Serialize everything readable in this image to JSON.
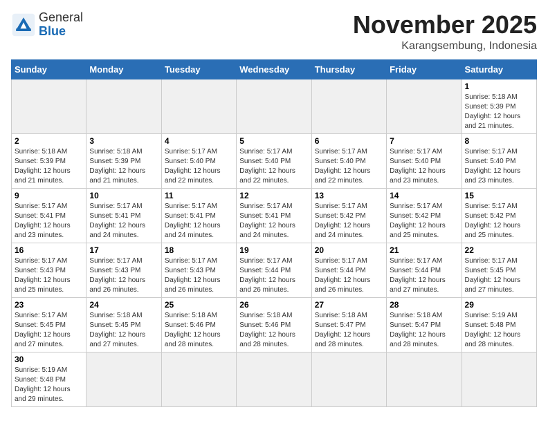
{
  "header": {
    "logo_general": "General",
    "logo_blue": "Blue",
    "title": "November 2025",
    "subtitle": "Karangsembung, Indonesia"
  },
  "weekdays": [
    "Sunday",
    "Monday",
    "Tuesday",
    "Wednesday",
    "Thursday",
    "Friday",
    "Saturday"
  ],
  "weeks": [
    [
      {
        "day": "",
        "empty": true
      },
      {
        "day": "",
        "empty": true
      },
      {
        "day": "",
        "empty": true
      },
      {
        "day": "",
        "empty": true
      },
      {
        "day": "",
        "empty": true
      },
      {
        "day": "",
        "empty": true
      },
      {
        "day": "1",
        "sunrise": "5:18 AM",
        "sunset": "5:39 PM",
        "daylight": "12 hours and 21 minutes."
      }
    ],
    [
      {
        "day": "2",
        "sunrise": "5:18 AM",
        "sunset": "5:39 PM",
        "daylight": "12 hours and 21 minutes."
      },
      {
        "day": "3",
        "sunrise": "5:18 AM",
        "sunset": "5:39 PM",
        "daylight": "12 hours and 21 minutes."
      },
      {
        "day": "4",
        "sunrise": "5:17 AM",
        "sunset": "5:40 PM",
        "daylight": "12 hours and 22 minutes."
      },
      {
        "day": "5",
        "sunrise": "5:17 AM",
        "sunset": "5:40 PM",
        "daylight": "12 hours and 22 minutes."
      },
      {
        "day": "6",
        "sunrise": "5:17 AM",
        "sunset": "5:40 PM",
        "daylight": "12 hours and 22 minutes."
      },
      {
        "day": "7",
        "sunrise": "5:17 AM",
        "sunset": "5:40 PM",
        "daylight": "12 hours and 23 minutes."
      },
      {
        "day": "8",
        "sunrise": "5:17 AM",
        "sunset": "5:40 PM",
        "daylight": "12 hours and 23 minutes."
      }
    ],
    [
      {
        "day": "9",
        "sunrise": "5:17 AM",
        "sunset": "5:41 PM",
        "daylight": "12 hours and 23 minutes."
      },
      {
        "day": "10",
        "sunrise": "5:17 AM",
        "sunset": "5:41 PM",
        "daylight": "12 hours and 24 minutes."
      },
      {
        "day": "11",
        "sunrise": "5:17 AM",
        "sunset": "5:41 PM",
        "daylight": "12 hours and 24 minutes."
      },
      {
        "day": "12",
        "sunrise": "5:17 AM",
        "sunset": "5:41 PM",
        "daylight": "12 hours and 24 minutes."
      },
      {
        "day": "13",
        "sunrise": "5:17 AM",
        "sunset": "5:42 PM",
        "daylight": "12 hours and 24 minutes."
      },
      {
        "day": "14",
        "sunrise": "5:17 AM",
        "sunset": "5:42 PM",
        "daylight": "12 hours and 25 minutes."
      },
      {
        "day": "15",
        "sunrise": "5:17 AM",
        "sunset": "5:42 PM",
        "daylight": "12 hours and 25 minutes."
      }
    ],
    [
      {
        "day": "16",
        "sunrise": "5:17 AM",
        "sunset": "5:43 PM",
        "daylight": "12 hours and 25 minutes."
      },
      {
        "day": "17",
        "sunrise": "5:17 AM",
        "sunset": "5:43 PM",
        "daylight": "12 hours and 26 minutes."
      },
      {
        "day": "18",
        "sunrise": "5:17 AM",
        "sunset": "5:43 PM",
        "daylight": "12 hours and 26 minutes."
      },
      {
        "day": "19",
        "sunrise": "5:17 AM",
        "sunset": "5:44 PM",
        "daylight": "12 hours and 26 minutes."
      },
      {
        "day": "20",
        "sunrise": "5:17 AM",
        "sunset": "5:44 PM",
        "daylight": "12 hours and 26 minutes."
      },
      {
        "day": "21",
        "sunrise": "5:17 AM",
        "sunset": "5:44 PM",
        "daylight": "12 hours and 27 minutes."
      },
      {
        "day": "22",
        "sunrise": "5:17 AM",
        "sunset": "5:45 PM",
        "daylight": "12 hours and 27 minutes."
      }
    ],
    [
      {
        "day": "23",
        "sunrise": "5:17 AM",
        "sunset": "5:45 PM",
        "daylight": "12 hours and 27 minutes."
      },
      {
        "day": "24",
        "sunrise": "5:18 AM",
        "sunset": "5:45 PM",
        "daylight": "12 hours and 27 minutes."
      },
      {
        "day": "25",
        "sunrise": "5:18 AM",
        "sunset": "5:46 PM",
        "daylight": "12 hours and 28 minutes."
      },
      {
        "day": "26",
        "sunrise": "5:18 AM",
        "sunset": "5:46 PM",
        "daylight": "12 hours and 28 minutes."
      },
      {
        "day": "27",
        "sunrise": "5:18 AM",
        "sunset": "5:47 PM",
        "daylight": "12 hours and 28 minutes."
      },
      {
        "day": "28",
        "sunrise": "5:18 AM",
        "sunset": "5:47 PM",
        "daylight": "12 hours and 28 minutes."
      },
      {
        "day": "29",
        "sunrise": "5:19 AM",
        "sunset": "5:48 PM",
        "daylight": "12 hours and 28 minutes."
      }
    ],
    [
      {
        "day": "30",
        "sunrise": "5:19 AM",
        "sunset": "5:48 PM",
        "daylight": "12 hours and 29 minutes."
      },
      {
        "day": "",
        "empty": true
      },
      {
        "day": "",
        "empty": true
      },
      {
        "day": "",
        "empty": true
      },
      {
        "day": "",
        "empty": true
      },
      {
        "day": "",
        "empty": true
      },
      {
        "day": "",
        "empty": true
      }
    ]
  ],
  "labels": {
    "sunrise": "Sunrise:",
    "sunset": "Sunset:",
    "daylight": "Daylight:"
  }
}
